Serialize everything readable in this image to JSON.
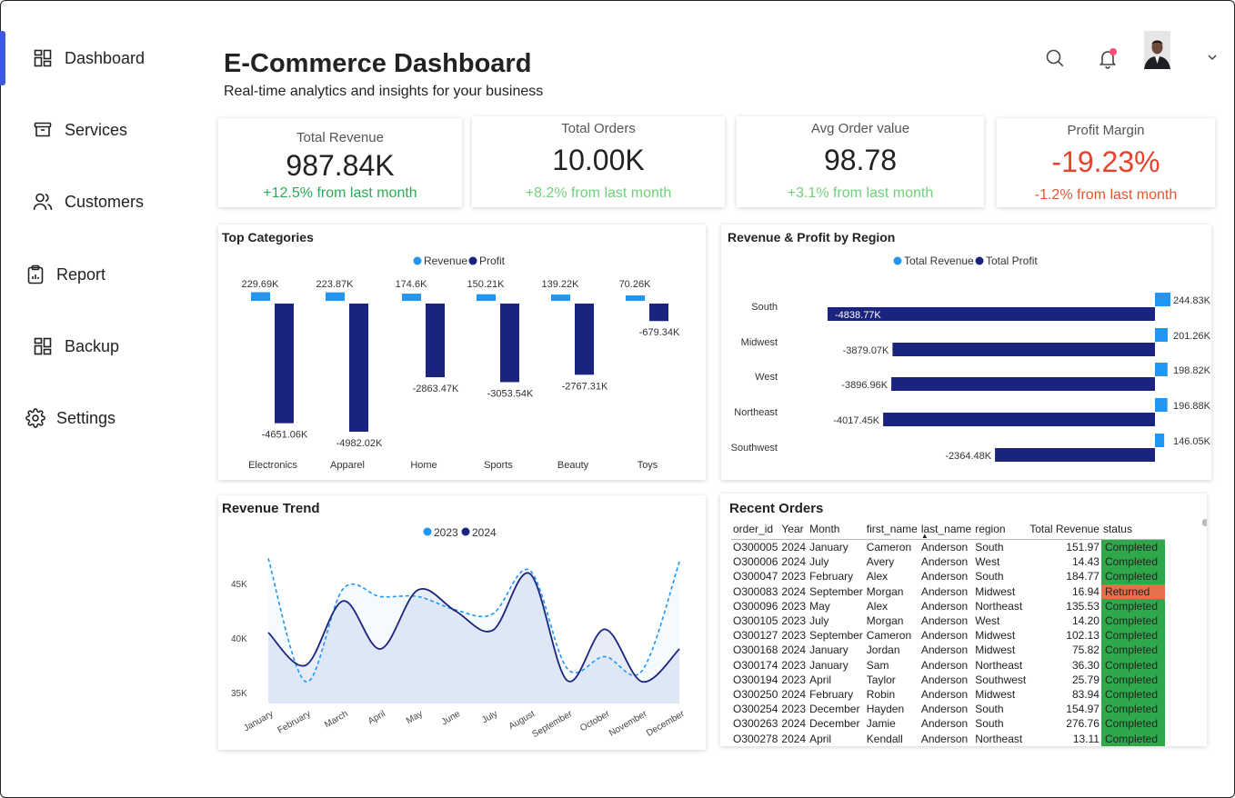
{
  "sidebar": {
    "items": [
      {
        "label": "Dashboard",
        "icon": "dashboard-grid-icon"
      },
      {
        "label": "Services",
        "icon": "archive-box-icon"
      },
      {
        "label": "Customers",
        "icon": "users-icon"
      },
      {
        "label": "Report",
        "icon": "clipboard-report-icon"
      },
      {
        "label": "Backup",
        "icon": "backup-grid-icon"
      },
      {
        "label": "Settings",
        "icon": "gear-icon"
      }
    ],
    "active_item": "Dashboard",
    "accent_color": "#3b5bdb"
  },
  "header": {
    "title": "E-Commerce Dashboard",
    "subtitle": "Real-time analytics and insights for your business",
    "icons": [
      "search-icon",
      "bell-icon",
      "avatar",
      "chevron-down-icon"
    ],
    "notification_dot_color": "#ff4d7a"
  },
  "kpis": [
    {
      "label": "Total Revenue",
      "value": "987.84K",
      "change": "+12.5% from last month",
      "change_color": "#2eaa55",
      "value_color": "#222222"
    },
    {
      "label": "Total Orders",
      "value": "10.00K",
      "change": "+8.2% from last month",
      "change_color": "#6fd17a",
      "value_color": "#222222"
    },
    {
      "label": "Avg Order value",
      "value": "98.78",
      "change": "+3.1% from last month",
      "change_color": "#6fd17a",
      "value_color": "#222222"
    },
    {
      "label": "Profit Margin",
      "value": "-19.23%",
      "change": "-1.2% from last month",
      "change_color": "#e8552c",
      "value_color": "#e8422c"
    }
  ],
  "top_categories": {
    "title": "Top Categories",
    "legend": [
      "Revenue",
      "Profit"
    ],
    "colors": {
      "Revenue": "#2196f3",
      "Profit": "#1a237e"
    },
    "chart_data": {
      "type": "bar",
      "categories": [
        "Electronics",
        "Apparel",
        "Home",
        "Sports",
        "Beauty",
        "Toys"
      ],
      "series": [
        {
          "name": "Revenue",
          "values": [
            229.69,
            223.87,
            174.6,
            150.21,
            139.22,
            70.26
          ],
          "labels": [
            "229.69K",
            "223.87K",
            "174.6K",
            "150.21K",
            "139.22K",
            "70.26K"
          ]
        },
        {
          "name": "Profit",
          "values": [
            -4651.06,
            -4982.02,
            -2863.47,
            -3053.54,
            -2767.31,
            -679.34
          ],
          "labels": [
            "-4651.06K",
            "-4982.02K",
            "-2863.47K",
            "-3053.54K",
            "-2767.31K",
            "-679.34K"
          ]
        }
      ]
    }
  },
  "region": {
    "title": "Revenue & Profit by Region",
    "legend": [
      "Total Revenue",
      "Total Profit"
    ],
    "colors": {
      "Total Revenue": "#2196f3",
      "Total Profit": "#1a237e"
    },
    "chart_data": {
      "type": "bar",
      "orientation": "horizontal",
      "categories": [
        "South",
        "Midwest",
        "West",
        "Northeast",
        "Southwest"
      ],
      "series": [
        {
          "name": "Total Revenue",
          "values": [
            244.83,
            201.26,
            198.82,
            196.88,
            146.05
          ],
          "labels": [
            "244.83K",
            "201.26K",
            "198.82K",
            "196.88K",
            "146.05K"
          ]
        },
        {
          "name": "Total Profit",
          "values": [
            -4838.77,
            -3879.07,
            -3896.96,
            -4017.45,
            -2364.48
          ],
          "labels": [
            "-4838.77K",
            "-3879.07K",
            "-3896.96K",
            "-4017.45K",
            "-2364.48K"
          ]
        }
      ]
    }
  },
  "trend": {
    "title": "Revenue Trend",
    "legend": [
      "2023",
      "2024"
    ],
    "colors": {
      "2023": "#2196f3",
      "2024": "#1a237e"
    },
    "chart_data": {
      "type": "line",
      "x": [
        "January",
        "February",
        "March",
        "April",
        "May",
        "June",
        "July",
        "August",
        "September",
        "October",
        "November",
        "December"
      ],
      "series": [
        {
          "name": "2023",
          "values": [
            47.3,
            36.0,
            44.5,
            43.8,
            43.8,
            42.6,
            42.2,
            46.2,
            37.2,
            38.3,
            37.0,
            47.0
          ]
        },
        {
          "name": "2024",
          "values": [
            40.5,
            37.5,
            43.4,
            39.0,
            44.4,
            42.5,
            40.7,
            45.9,
            36.1,
            40.8,
            36.0,
            39.0
          ]
        }
      ],
      "yticks": [
        "35K",
        "40K",
        "45K"
      ],
      "ylim": [
        34,
        48
      ]
    }
  },
  "orders": {
    "title": "Recent Orders",
    "columns": [
      "order_id",
      "Year",
      "Month",
      "first_name",
      "last_name",
      "region",
      "Total Revenue",
      "status"
    ],
    "sorted_column": "last_name",
    "rows": [
      [
        "O300005",
        "2024",
        "January",
        "Cameron",
        "Anderson",
        "South",
        "151.97",
        "Completed"
      ],
      [
        "O300006",
        "2024",
        "July",
        "Avery",
        "Anderson",
        "West",
        "14.43",
        "Completed"
      ],
      [
        "O300047",
        "2023",
        "February",
        "Alex",
        "Anderson",
        "South",
        "184.77",
        "Completed"
      ],
      [
        "O300083",
        "2024",
        "September",
        "Morgan",
        "Anderson",
        "Midwest",
        "16.94",
        "Returned"
      ],
      [
        "O300096",
        "2023",
        "May",
        "Alex",
        "Anderson",
        "Northeast",
        "135.53",
        "Completed"
      ],
      [
        "O300105",
        "2023",
        "July",
        "Morgan",
        "Anderson",
        "West",
        "14.20",
        "Completed"
      ],
      [
        "O300127",
        "2023",
        "September",
        "Cameron",
        "Anderson",
        "Midwest",
        "102.13",
        "Completed"
      ],
      [
        "O300168",
        "2024",
        "January",
        "Jordan",
        "Anderson",
        "Midwest",
        "75.82",
        "Completed"
      ],
      [
        "O300174",
        "2023",
        "January",
        "Sam",
        "Anderson",
        "Northeast",
        "36.30",
        "Completed"
      ],
      [
        "O300194",
        "2023",
        "April",
        "Taylor",
        "Anderson",
        "Southwest",
        "25.79",
        "Completed"
      ],
      [
        "O300250",
        "2024",
        "February",
        "Robin",
        "Anderson",
        "Midwest",
        "83.94",
        "Completed"
      ],
      [
        "O300254",
        "2023",
        "December",
        "Hayden",
        "Anderson",
        "South",
        "154.97",
        "Completed"
      ],
      [
        "O300263",
        "2024",
        "December",
        "Jamie",
        "Anderson",
        "South",
        "276.76",
        "Completed"
      ],
      [
        "O300278",
        "2024",
        "April",
        "Kendall",
        "Anderson",
        "Northeast",
        "13.11",
        "Completed"
      ]
    ],
    "status_colors": {
      "Completed": "#2ea84a",
      "Returned": "#e6704a"
    }
  }
}
